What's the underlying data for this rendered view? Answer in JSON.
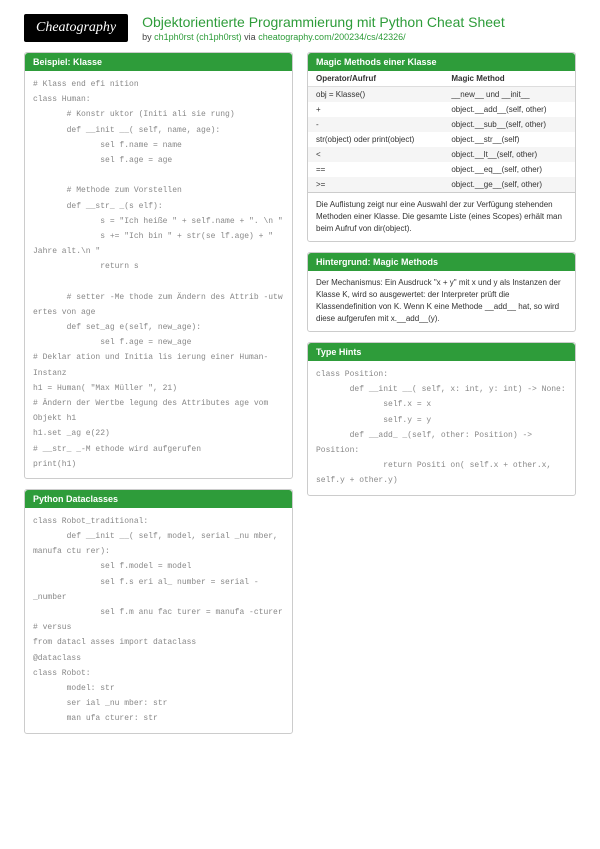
{
  "header": {
    "logo": "Cheatography",
    "title": "Objektorientierte Programmierung mit Python Cheat Sheet",
    "by": "by ",
    "author": "ch1ph0rst (ch1ph0rst)",
    "via": " via ",
    "url": "cheatography.com/200234/cs/42326/"
  },
  "blocks": {
    "beispiel": {
      "title": "Beispiel: Klasse",
      "code": "# Klass end efi nition\nclass Human:\n       # Konstr uktor (Initi ali sie rung)\n       def __init __( self, name, age):\n              sel f.name = name\n              sel f.age = age\n\n       # Methode zum Vorstellen\n       def __str_ _(s elf):\n              s = \"Ich heiße \" + self.name + \". \\n \"\n              s += \"Ich bin \" + str(se lf.age) + \" Jahre alt.\\n \"\n              return s\n\n       # setter -Me thode zum Ändern des Attrib -utw ertes von age\n       def set_ag e(self, new_age):\n              sel f.age = new_age\n# Deklar ation und Initia lis ierung einer Human- Instanz\nh1 = Human( \"Max Müller \", 21)\n# Ändern der Wertbe legung des Attributes age vom Objekt h1\nh1.set _ag e(22)\n# __str_ _-M ethode wird aufgerufen\nprint(h1)"
    },
    "dataclasses": {
      "title": "Python Dataclasses",
      "code": "class Robot_traditional:\n       def __init __( self, model, serial _nu mber, manufa ctu rer):\n              sel f.model = model\n              sel f.s eri al_ number = serial -_number\n              sel f.m anu fac turer = manufa -cturer\n# versus\nfrom datacl asses import dataclass\n@dataclass\nclass Robot:\n       model: str\n       ser ial _nu mber: str\n       man ufa cturer: str"
    },
    "magic": {
      "title": "Magic Methods einer Klasse",
      "headers": [
        "Operator/Aufruf",
        "Magic Method"
      ],
      "rows": [
        [
          "obj = Klasse()",
          "__new__ und __init__"
        ],
        [
          "+",
          "object.__add__(self, other)"
        ],
        [
          "-",
          "object.__sub__(self, other)"
        ],
        [
          "str(object) oder print(object)",
          "object.__str__(self)"
        ],
        [
          "<",
          "object.__lt__(self, other)"
        ],
        [
          "==",
          "object.__eq__(self, other)"
        ],
        [
          ">=",
          "object.__ge__(self, other)"
        ]
      ],
      "note": "Die Auflistung zeigt nur eine Auswahl der zur Verfügung stehenden Methoden einer Klasse. Die gesamte Liste (eines Scopes) erhält man beim Aufruf von dir(object)."
    },
    "hintergrund": {
      "title": "Hintergrund: Magic Methods",
      "text": "Der Mechanismus: Ein Ausdruck \"x + y\" mit x und y als Instanzen der Klasse K, wird so ausgewertet: der Interpreter prüft die Klassendefinition von K. Wenn K eine Methode __add__ hat, so wird diese aufgerufen mit x.__add__(y)."
    },
    "typehints": {
      "title": "Type Hints",
      "code": "class Position:\n       def __init __( self, x: int, y: int) -> None:\n              self.x = x\n              self.y = y\n       def __add_ _(self, other: Position) -> Position:\n              return Positi on( self.x + other.x, self.y + other.y)"
    }
  }
}
